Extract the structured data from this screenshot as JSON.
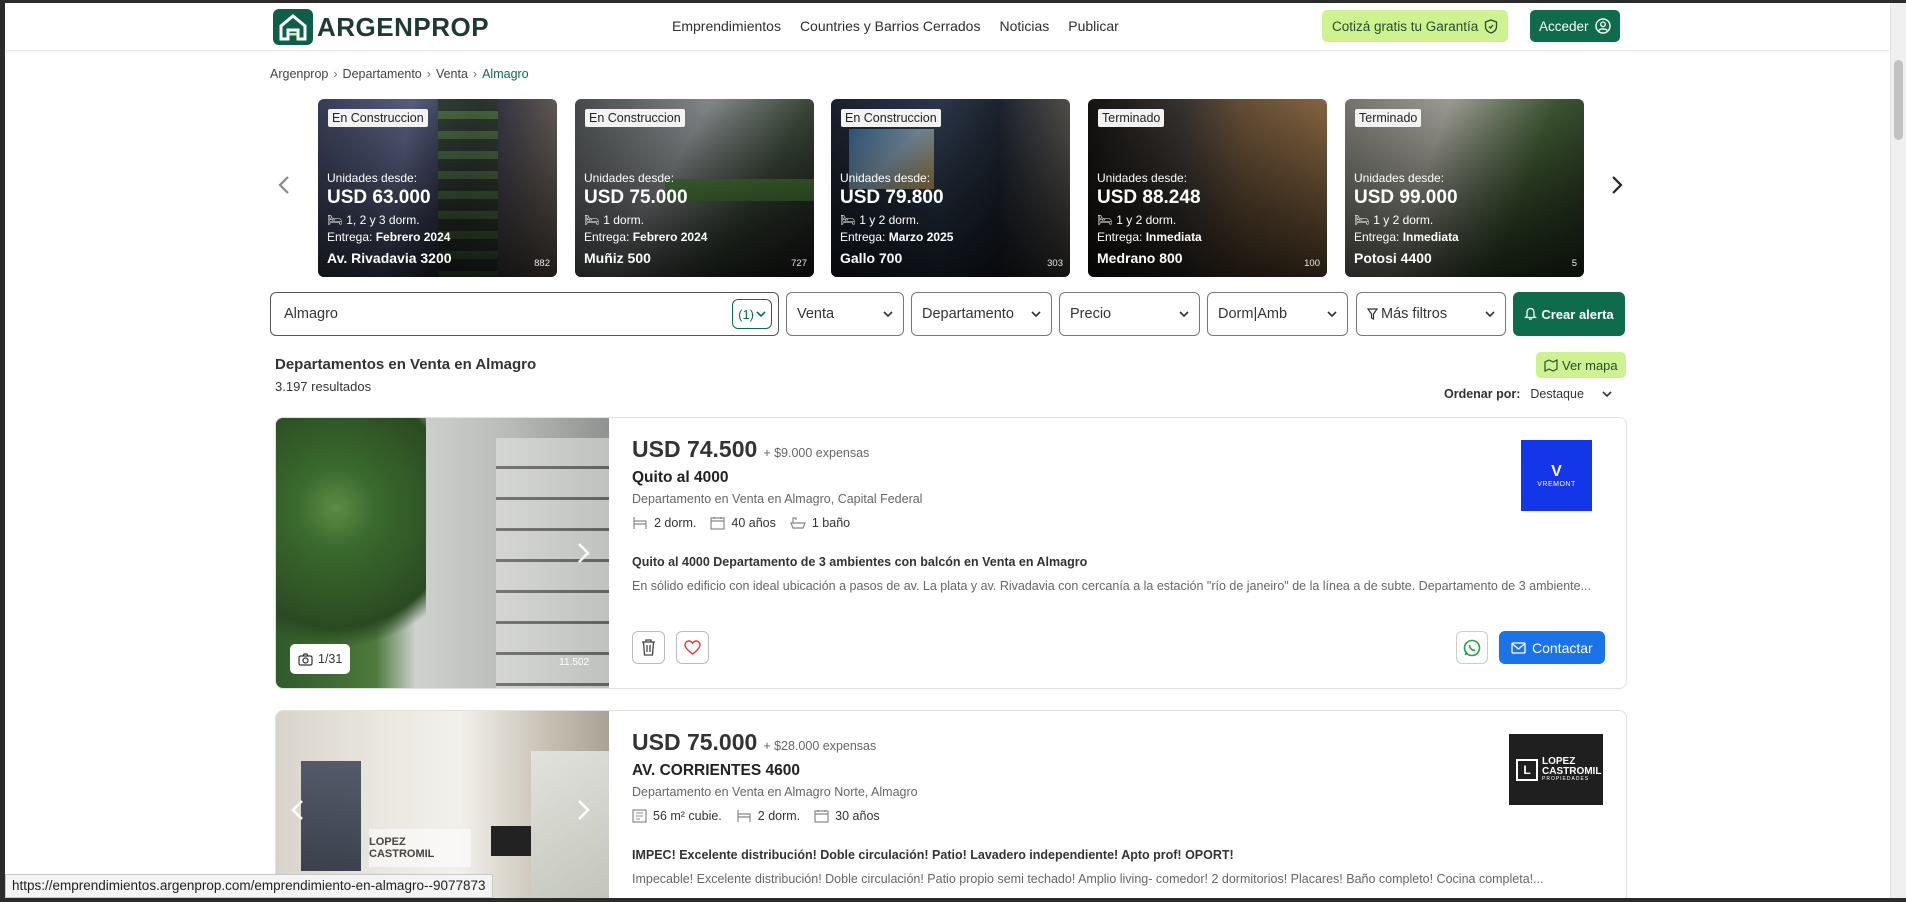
{
  "header": {
    "logo_text": "ARGENPROP",
    "nav": [
      "Emprendimientos",
      "Countries y Barrios Cerrados",
      "Noticias",
      "Publicar"
    ],
    "guarantee_label": "Cotizá gratis tu Garantía",
    "login_label": "Acceder"
  },
  "breadcrumb": [
    "Argenprop",
    "Departamento",
    "Venta",
    "Almagro"
  ],
  "carousel": [
    {
      "tag": "En Construccion",
      "from": "Unidades desde:",
      "price": "USD 63.000",
      "dorms": "1, 2 y 3 dorm.",
      "delivery_label": "Entrega:",
      "delivery": "Febrero 2024",
      "address": "Av. Rivadavia 3200",
      "num": "882"
    },
    {
      "tag": "En Construccion",
      "from": "Unidades desde:",
      "price": "USD 75.000",
      "dorms": "1 dorm.",
      "delivery_label": "Entrega:",
      "delivery": "Febrero 2024",
      "address": "Muñiz 500",
      "num": "727"
    },
    {
      "tag": "En Construccion",
      "from": "Unidades desde:",
      "price": "USD 79.800",
      "dorms": "1 y 2 dorm.",
      "delivery_label": "Entrega:",
      "delivery": "Marzo 2025",
      "address": "Gallo 700",
      "num": "303"
    },
    {
      "tag": "Terminado",
      "from": "Unidades desde:",
      "price": "USD 88.248",
      "dorms": "1 y 2 dorm.",
      "delivery_label": "Entrega:",
      "delivery": "Inmediata",
      "address": "Medrano 800",
      "num": "100"
    },
    {
      "tag": "Terminado",
      "from": "Unidades desde:",
      "price": "USD 99.000",
      "dorms": "1 y 2 dorm.",
      "delivery_label": "Entrega:",
      "delivery": "Inmediata",
      "address": "Potosi 4400",
      "num": "5"
    }
  ],
  "filters": {
    "search_value": "Almagro",
    "search_count": "(1)",
    "operation": "Venta",
    "property_type": "Departamento",
    "price": "Precio",
    "rooms": "Dorm|Amb",
    "more": "Más filtros",
    "alert": "Crear alerta"
  },
  "results": {
    "title": "Departamentos en Venta en Almagro",
    "count": "3.197 resultados",
    "map_label": "Ver mapa",
    "sort_label": "Ordenar por:",
    "sort_value": "Destaque"
  },
  "listings": [
    {
      "price": "USD 74.500",
      "expenses": "+ $9.000 expensas",
      "street": "Quito al 4000",
      "type": "Departamento en Venta en Almagro, Capital Federal",
      "features": [
        "2 dorm.",
        "40 años",
        "1 baño"
      ],
      "desc_title": "Quito al 4000 Departamento de 3 ambientes con balcón en Venta en Almagro",
      "desc": "En sólido edificio con ideal ubicación a pasos de av. La plata y av. Rivadavia con cercanía a la estación \"río de janeiro\" de la línea a de subte. Departamento de 3 ambiente...",
      "photo_counter": "1/31",
      "photo_id": "11.502",
      "agency": "VREMONT",
      "contact": "Contactar"
    },
    {
      "price": "USD 75.000",
      "expenses": "+ $28.000 expensas",
      "street": "AV. CORRIENTES 4600",
      "type": "Departamento en Venta en Almagro Norte, Almagro",
      "features": [
        "56 m² cubie.",
        "2 dorm.",
        "30 años"
      ],
      "desc_title": "IMPEC! Excelente distribución! Doble circulación! Patio! Lavadero independiente! Apto prof! OPORT!",
      "desc": "Impecable! Excelente distribución! Doble circulación! Patio propio semi techado! Amplio living- comedor! 2 dormitorios! Placares! Baño completo! Cocina completa!...",
      "agency": "LOPEZ CASTROMIL",
      "agency_sub": "PROPIEDADES",
      "watermark": "LOPEZ CASTROMIL"
    }
  ],
  "status_url": "https://emprendimientos.argenprop.com/emprendimiento-en-almagro--9077873",
  "colors": {
    "brand": "#0e6b4c",
    "accent_lime": "#cdf28f",
    "contact_blue": "#1a73e8"
  }
}
